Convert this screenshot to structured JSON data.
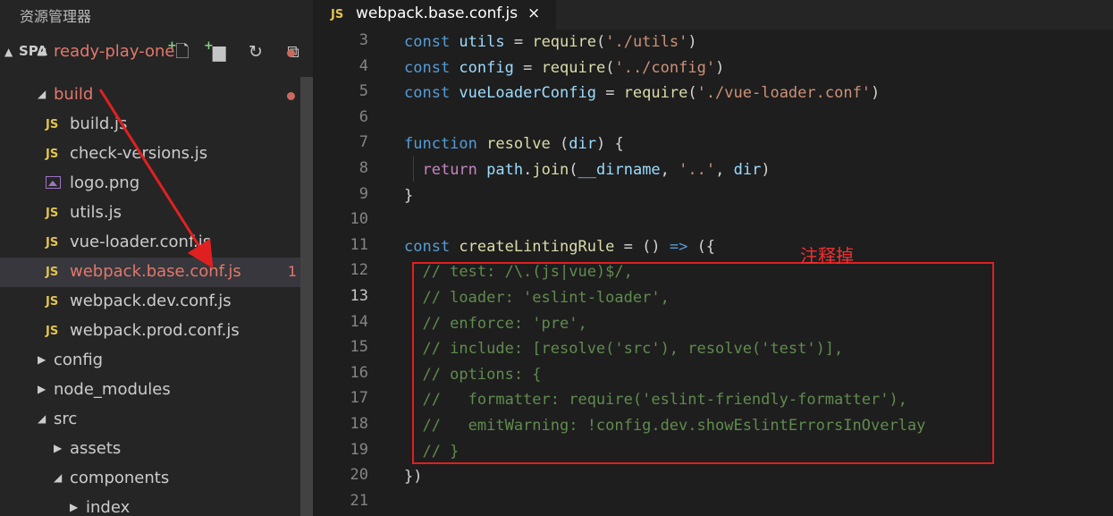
{
  "sidebar": {
    "title": "资源管理器",
    "section_label": "SPA",
    "toolbar": [
      {
        "name": "new-file-icon"
      },
      {
        "name": "new-folder-icon"
      },
      {
        "name": "refresh-icon"
      },
      {
        "name": "collapse-all-icon"
      }
    ],
    "items": [
      {
        "label": "ready-play-one",
        "type": "folder",
        "expanded": true,
        "modified": true
      },
      {
        "label": "build",
        "type": "folder",
        "expanded": true,
        "modified": true
      },
      {
        "label": "build.js",
        "type": "js"
      },
      {
        "label": "check-versions.js",
        "type": "js"
      },
      {
        "label": "logo.png",
        "type": "image"
      },
      {
        "label": "utils.js",
        "type": "js"
      },
      {
        "label": "vue-loader.conf.js",
        "type": "js"
      },
      {
        "label": "webpack.base.conf.js",
        "type": "js",
        "modified": true,
        "badge": "1",
        "selected": true
      },
      {
        "label": "webpack.dev.conf.js",
        "type": "js"
      },
      {
        "label": "webpack.prod.conf.js",
        "type": "js"
      },
      {
        "label": "config",
        "type": "folder",
        "expanded": false
      },
      {
        "label": "node_modules",
        "type": "folder",
        "expanded": false
      },
      {
        "label": "src",
        "type": "folder",
        "expanded": true
      },
      {
        "label": "assets",
        "type": "folder",
        "expanded": false
      },
      {
        "label": "components",
        "type": "folder",
        "expanded": true
      },
      {
        "label": "index",
        "type": "folder",
        "expanded": false
      }
    ]
  },
  "editor": {
    "tab": {
      "icon": "JS",
      "title": "webpack.base.conf.js",
      "close": "×"
    },
    "active_line": 13,
    "lines": [
      {
        "n": "3",
        "tokens": [
          {
            "t": "const ",
            "c": "kw"
          },
          {
            "t": "utils",
            "c": "vr"
          },
          {
            "t": " = ",
            "c": "op"
          },
          {
            "t": "require",
            "c": "fn"
          },
          {
            "t": "(",
            "c": "op"
          },
          {
            "t": "'./utils'",
            "c": "st"
          },
          {
            "t": ")",
            "c": "op"
          }
        ]
      },
      {
        "n": "4",
        "tokens": [
          {
            "t": "const ",
            "c": "kw"
          },
          {
            "t": "config",
            "c": "vr"
          },
          {
            "t": " = ",
            "c": "op"
          },
          {
            "t": "require",
            "c": "fn"
          },
          {
            "t": "(",
            "c": "op"
          },
          {
            "t": "'../config'",
            "c": "st"
          },
          {
            "t": ")",
            "c": "op"
          }
        ]
      },
      {
        "n": "5",
        "tokens": [
          {
            "t": "const ",
            "c": "kw"
          },
          {
            "t": "vueLoaderConfig",
            "c": "vr"
          },
          {
            "t": " = ",
            "c": "op"
          },
          {
            "t": "require",
            "c": "fn"
          },
          {
            "t": "(",
            "c": "op"
          },
          {
            "t": "'./vue-loader.conf'",
            "c": "st"
          },
          {
            "t": ")",
            "c": "op"
          }
        ]
      },
      {
        "n": "6",
        "tokens": []
      },
      {
        "n": "7",
        "tokens": [
          {
            "t": "function ",
            "c": "kw"
          },
          {
            "t": "resolve",
            "c": "fn"
          },
          {
            "t": " (",
            "c": "op"
          },
          {
            "t": "dir",
            "c": "vr"
          },
          {
            "t": ") {",
            "c": "op"
          }
        ]
      },
      {
        "n": "8",
        "tokens": [
          {
            "t": "  ",
            "c": "op"
          },
          {
            "t": "return ",
            "c": "ct"
          },
          {
            "t": "path",
            "c": "vr"
          },
          {
            "t": ".",
            "c": "op"
          },
          {
            "t": "join",
            "c": "fn"
          },
          {
            "t": "(",
            "c": "op"
          },
          {
            "t": "__dirname",
            "c": "vr"
          },
          {
            "t": ", ",
            "c": "op"
          },
          {
            "t": "'..'",
            "c": "st"
          },
          {
            "t": ", ",
            "c": "op"
          },
          {
            "t": "dir",
            "c": "vr"
          },
          {
            "t": ")",
            "c": "op"
          }
        ]
      },
      {
        "n": "9",
        "tokens": [
          {
            "t": "}",
            "c": "op"
          }
        ]
      },
      {
        "n": "10",
        "tokens": []
      },
      {
        "n": "11",
        "tokens": [
          {
            "t": "const ",
            "c": "kw"
          },
          {
            "t": "createLintingRule",
            "c": "fn"
          },
          {
            "t": " = () ",
            "c": "op"
          },
          {
            "t": "=>",
            "c": "kw"
          },
          {
            "t": " ({",
            "c": "op"
          }
        ]
      },
      {
        "n": "12",
        "tokens": [
          {
            "t": "  // test: /\\.(js|vue)$/,",
            "c": "cm"
          }
        ]
      },
      {
        "n": "13",
        "tokens": [
          {
            "t": "  // loader: 'eslint-loader',",
            "c": "cm"
          }
        ]
      },
      {
        "n": "14",
        "tokens": [
          {
            "t": "  // enforce: 'pre',",
            "c": "cm"
          }
        ]
      },
      {
        "n": "15",
        "tokens": [
          {
            "t": "  // include: [resolve('src'), resolve('test')],",
            "c": "cm"
          }
        ]
      },
      {
        "n": "16",
        "tokens": [
          {
            "t": "  // options: {",
            "c": "cm"
          }
        ]
      },
      {
        "n": "17",
        "tokens": [
          {
            "t": "  //   formatter: require('eslint-friendly-formatter'),",
            "c": "cm"
          }
        ]
      },
      {
        "n": "18",
        "tokens": [
          {
            "t": "  //   emitWarning: !config.dev.showEslintErrorsInOverlay",
            "c": "cm"
          }
        ]
      },
      {
        "n": "19",
        "tokens": [
          {
            "t": "  // }",
            "c": "cm"
          }
        ]
      },
      {
        "n": "20",
        "tokens": [
          {
            "t": "})",
            "c": "op"
          }
        ]
      },
      {
        "n": "21",
        "tokens": []
      }
    ]
  },
  "annotation": {
    "label": "注释掉",
    "color": "#e02020"
  },
  "colors": {
    "modified": "#e2786a",
    "js_icon": "#e2c34f",
    "comment": "#608b4e",
    "keyword": "#569cd6"
  }
}
